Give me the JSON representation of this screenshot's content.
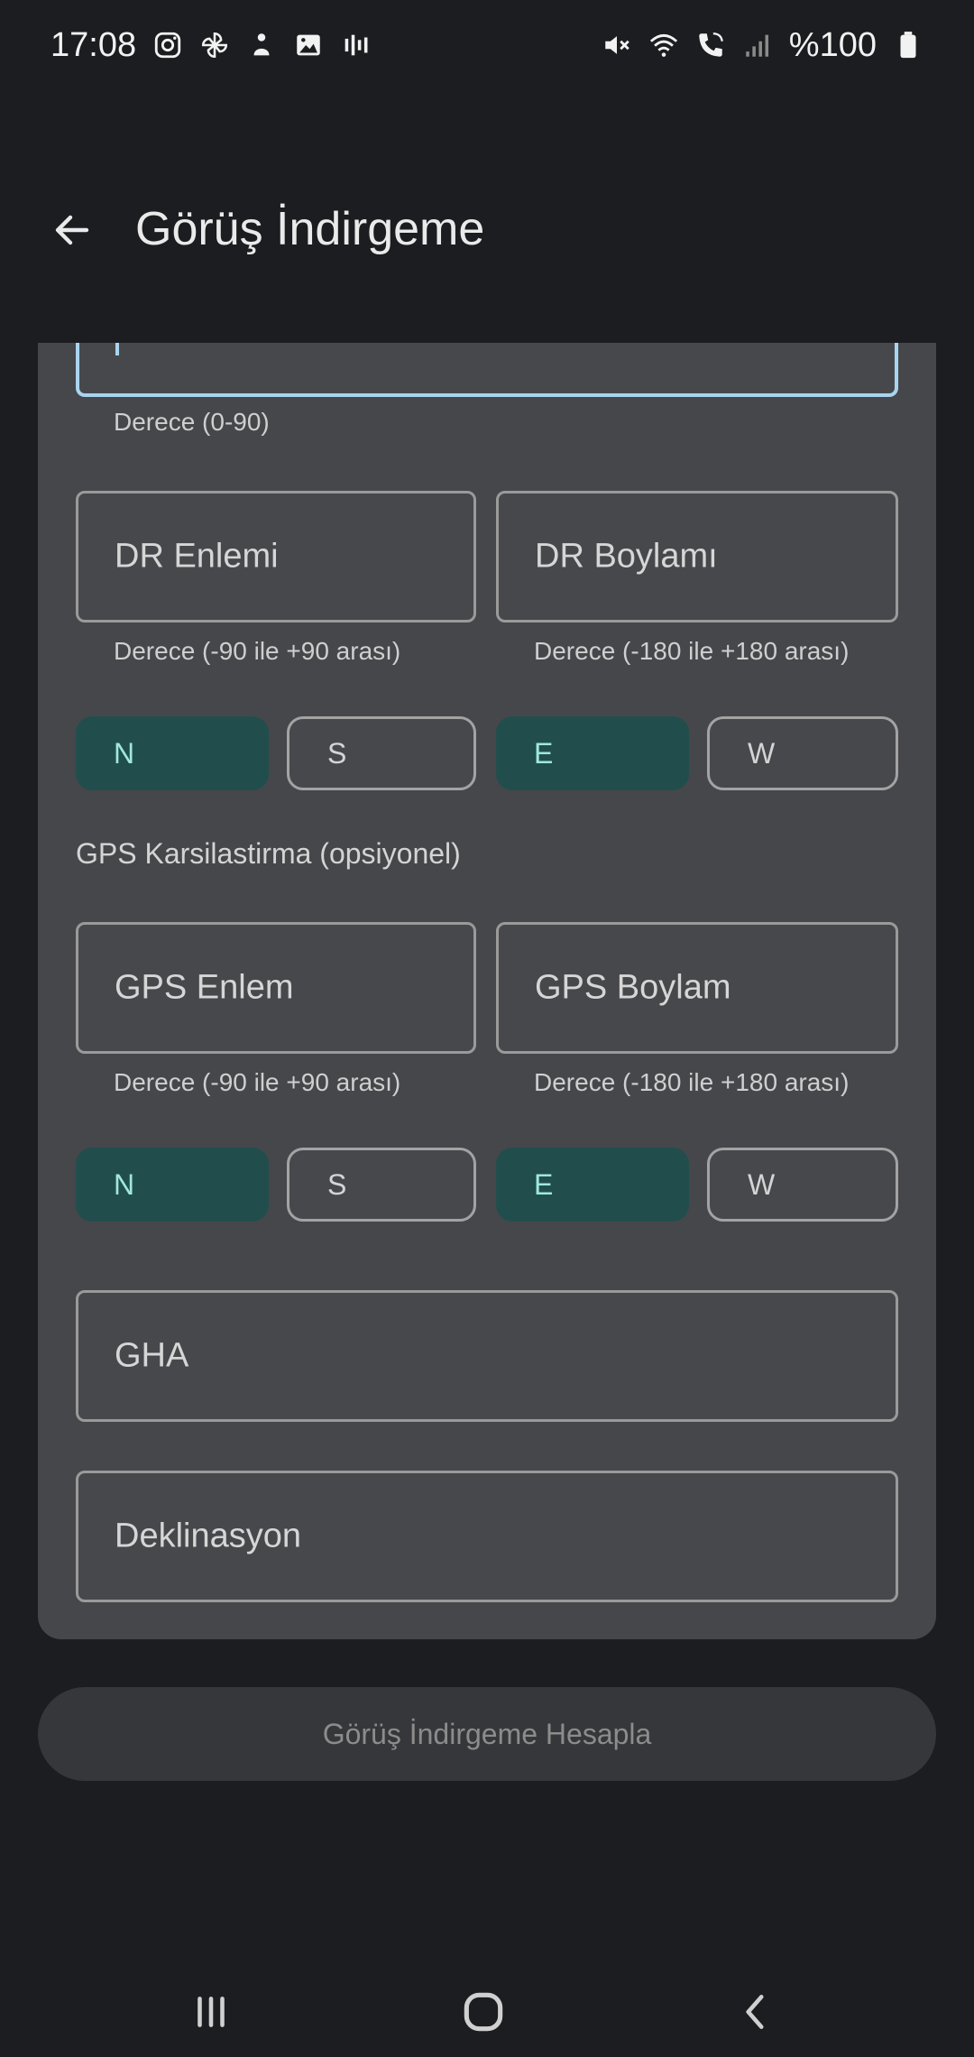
{
  "status_bar": {
    "time": "17:08",
    "battery": "%100",
    "left_icons": [
      "instagram-icon",
      "pinwheel-icon",
      "person-icon",
      "image-icon",
      "equalizer-icon"
    ],
    "right_icons": [
      "mute-icon",
      "wifi-icon",
      "wifi-call-icon",
      "signal-icon",
      "battery-icon"
    ]
  },
  "app_bar": {
    "title": "Görüş İndirgeme",
    "back_icon": "arrow-left-icon"
  },
  "form": {
    "focused_field_helper": "Derece (0-90)",
    "dr_lat": {
      "label": "DR Enlemi",
      "helper": "Derece (-90 ile +90 arası)"
    },
    "dr_lon": {
      "label": "DR Boylamı",
      "helper": "Derece (-180 ile +180 arası)"
    },
    "dr_toggles": [
      {
        "label": "N",
        "selected": true
      },
      {
        "label": "S",
        "selected": false
      },
      {
        "label": "E",
        "selected": true
      },
      {
        "label": "W",
        "selected": false
      }
    ],
    "gps_section_title": "GPS Karsilastirma (opsiyonel)",
    "gps_lat": {
      "label": "GPS Enlem",
      "helper": "Derece (-90 ile +90 arası)"
    },
    "gps_lon": {
      "label": "GPS Boylam",
      "helper": "Derece (-180 ile +180 arası)"
    },
    "gps_toggles": [
      {
        "label": "N",
        "selected": true
      },
      {
        "label": "S",
        "selected": false
      },
      {
        "label": "E",
        "selected": true
      },
      {
        "label": "W",
        "selected": false
      }
    ],
    "gha": {
      "label": "GHA"
    },
    "declination": {
      "label": "Deklinasyon"
    }
  },
  "calculate_button": {
    "label": "Görüş İndirgeme Hesapla"
  },
  "nav_bar": {
    "icons": [
      "recent-apps-icon",
      "home-icon",
      "back-icon"
    ]
  },
  "colors": {
    "background": "#1c1d20",
    "card": "#46474b",
    "toggle_selected": "#214e4c",
    "toggle_selected_text": "#9fe8dc",
    "focus": "#a9d4f0"
  }
}
